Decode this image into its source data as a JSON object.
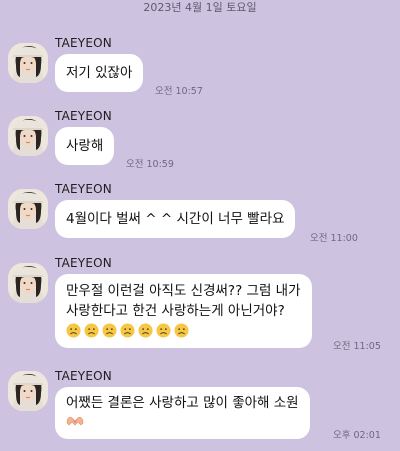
{
  "date_divider": "2023년 4월 1일 토요일",
  "messages": [
    {
      "sender": "TAEYEON",
      "text": "저기 있잖아",
      "time": "오전 10:57"
    },
    {
      "sender": "TAEYEON",
      "text": "사랑해",
      "time": "오전 10:59"
    },
    {
      "sender": "TAEYEON",
      "text": "4월이다 벌써 ^ ^ 시간이 너무 빨라요",
      "time": "오전 11:00"
    },
    {
      "sender": "TAEYEON",
      "line1": "만우절 이런걸 아직도 신경써?? 그럼 내가",
      "line2": "사랑한다고 한건 사랑하는게 아닌거야?",
      "emoji_count": 7,
      "emoji": "frowning-face",
      "time": "오전 11:05"
    },
    {
      "sender": "TAEYEON",
      "text": "어쨌든 결론은 사랑하고 많이 좋아해 소원",
      "emoji": "heart-hands",
      "time": "오후 02:01"
    }
  ],
  "colors": {
    "background": "#cdc3e0",
    "bubble": "#ffffff",
    "emoji_face": "#f6c744"
  }
}
